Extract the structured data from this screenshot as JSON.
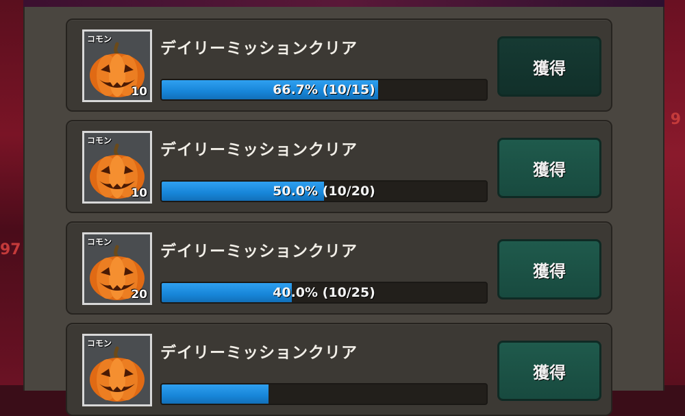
{
  "edge": {
    "right_digit": "9",
    "left_digits": "97"
  },
  "missions": [
    {
      "rarity": "コモン",
      "quantity": "10",
      "title": "デイリーミッションクリア",
      "progress_fraction": 0.667,
      "progress_text": "66.7% (10/15)",
      "button_label": "獲得"
    },
    {
      "rarity": "コモン",
      "quantity": "10",
      "title": "デイリーミッションクリア",
      "progress_fraction": 0.5,
      "progress_text": "50.0% (10/20)",
      "button_label": "獲得"
    },
    {
      "rarity": "コモン",
      "quantity": "20",
      "title": "デイリーミッションクリア",
      "progress_fraction": 0.4,
      "progress_text": "40.0% (10/25)",
      "button_label": "獲得"
    },
    {
      "rarity": "コモン",
      "quantity": "",
      "title": "デイリーミッションクリア",
      "progress_fraction": 0.33,
      "progress_text": "",
      "button_label": "獲得"
    }
  ],
  "colors": {
    "progress": "#1785d8",
    "button": "#1f5a4c",
    "card": "#3c3934"
  },
  "icons": {
    "item": "pumpkin-icon"
  }
}
